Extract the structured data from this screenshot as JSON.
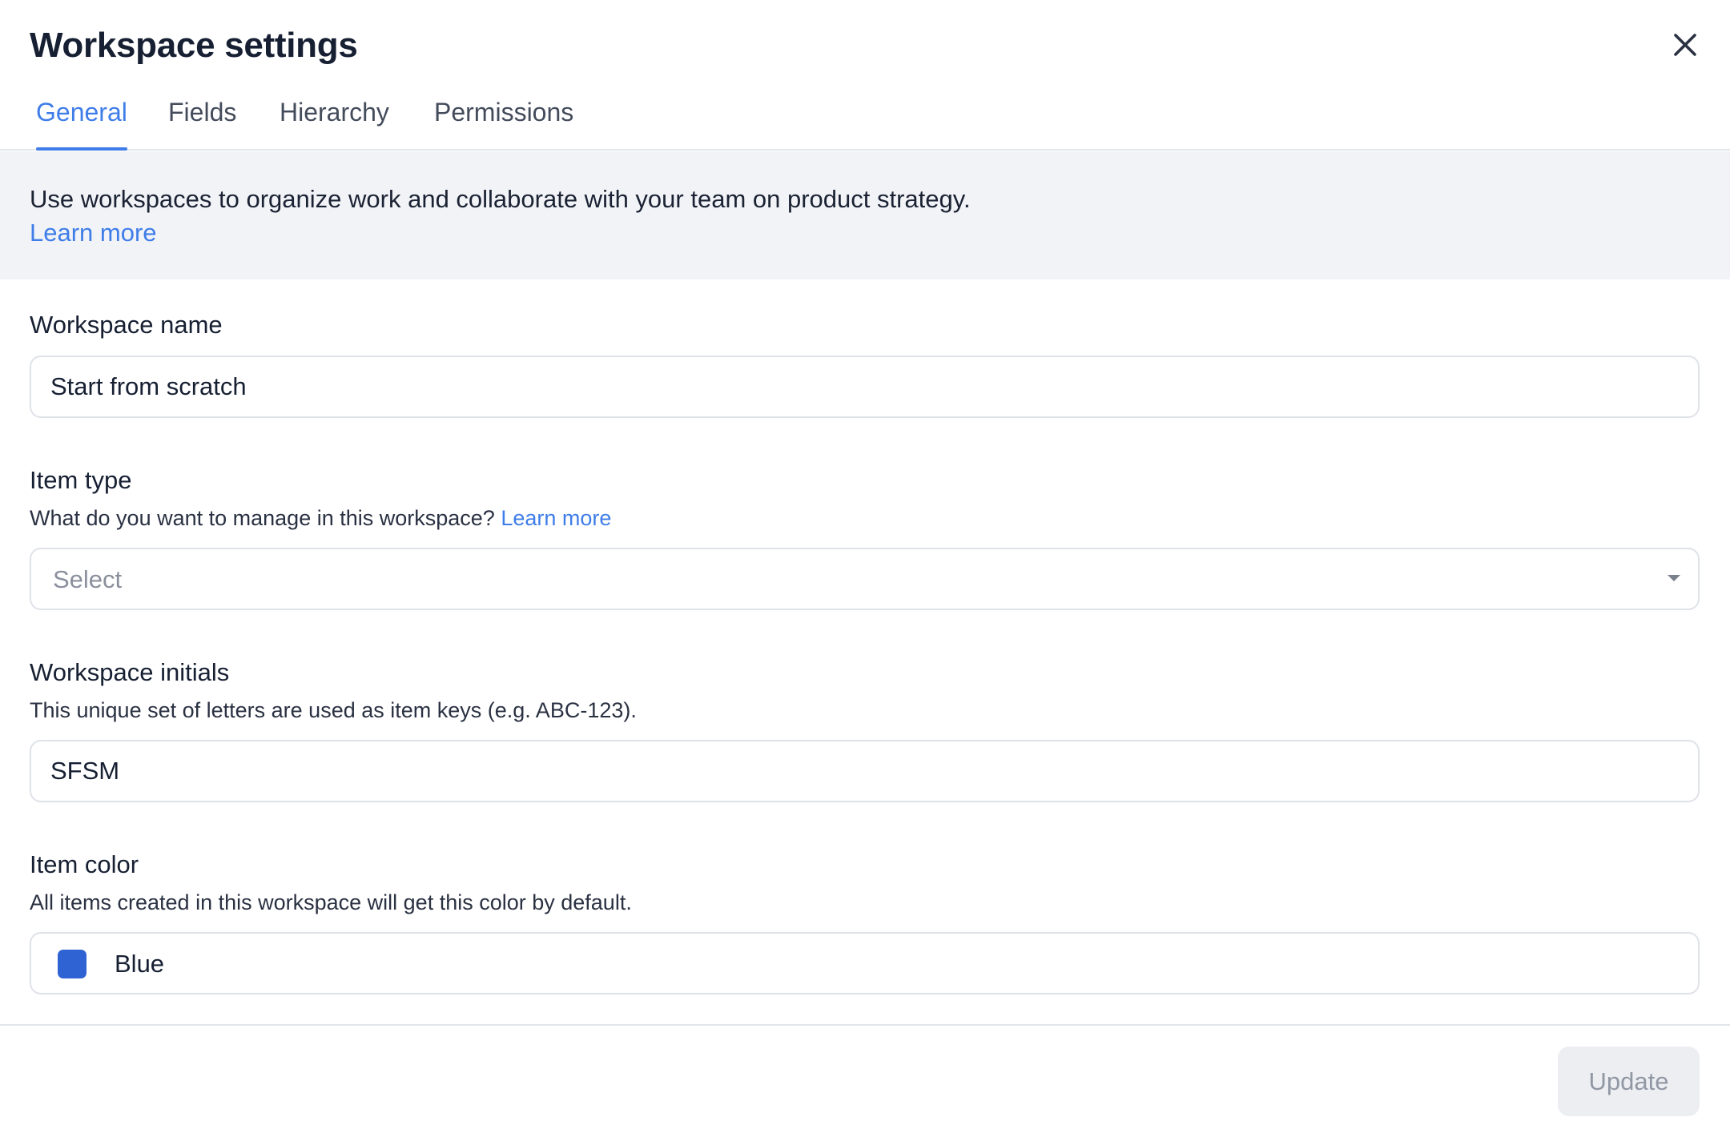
{
  "dialog": {
    "title": "Workspace settings"
  },
  "tabs": [
    {
      "label": "General",
      "active": true
    },
    {
      "label": "Fields",
      "active": false
    },
    {
      "label": "Hierarchy",
      "active": false
    },
    {
      "label": "Permissions",
      "active": false
    }
  ],
  "banner": {
    "text": "Use workspaces to organize work and collaborate with your team on product strategy.",
    "link": "Learn more"
  },
  "fields": {
    "workspace_name": {
      "label": "Workspace name",
      "value": "Start from scratch"
    },
    "item_type": {
      "label": "Item type",
      "help": "What do you want to manage in this workspace?",
      "help_link": "Learn more",
      "placeholder": "Select"
    },
    "workspace_initials": {
      "label": "Workspace initials",
      "help": "This unique set of letters are used as item keys (e.g. ABC-123).",
      "value": "SFSM"
    },
    "item_color": {
      "label": "Item color",
      "help": "All items created in this workspace will get this color by default.",
      "value": "Blue",
      "swatch_color": "#2f63d3"
    }
  },
  "footer": {
    "update_label": "Update"
  },
  "icons": {
    "close": "close-icon",
    "dropdown": "chevron-down-icon"
  },
  "colors": {
    "accent": "#3f7de8",
    "banner_bg": "#f1f3f7",
    "disabled_button_bg": "#eceef2"
  }
}
